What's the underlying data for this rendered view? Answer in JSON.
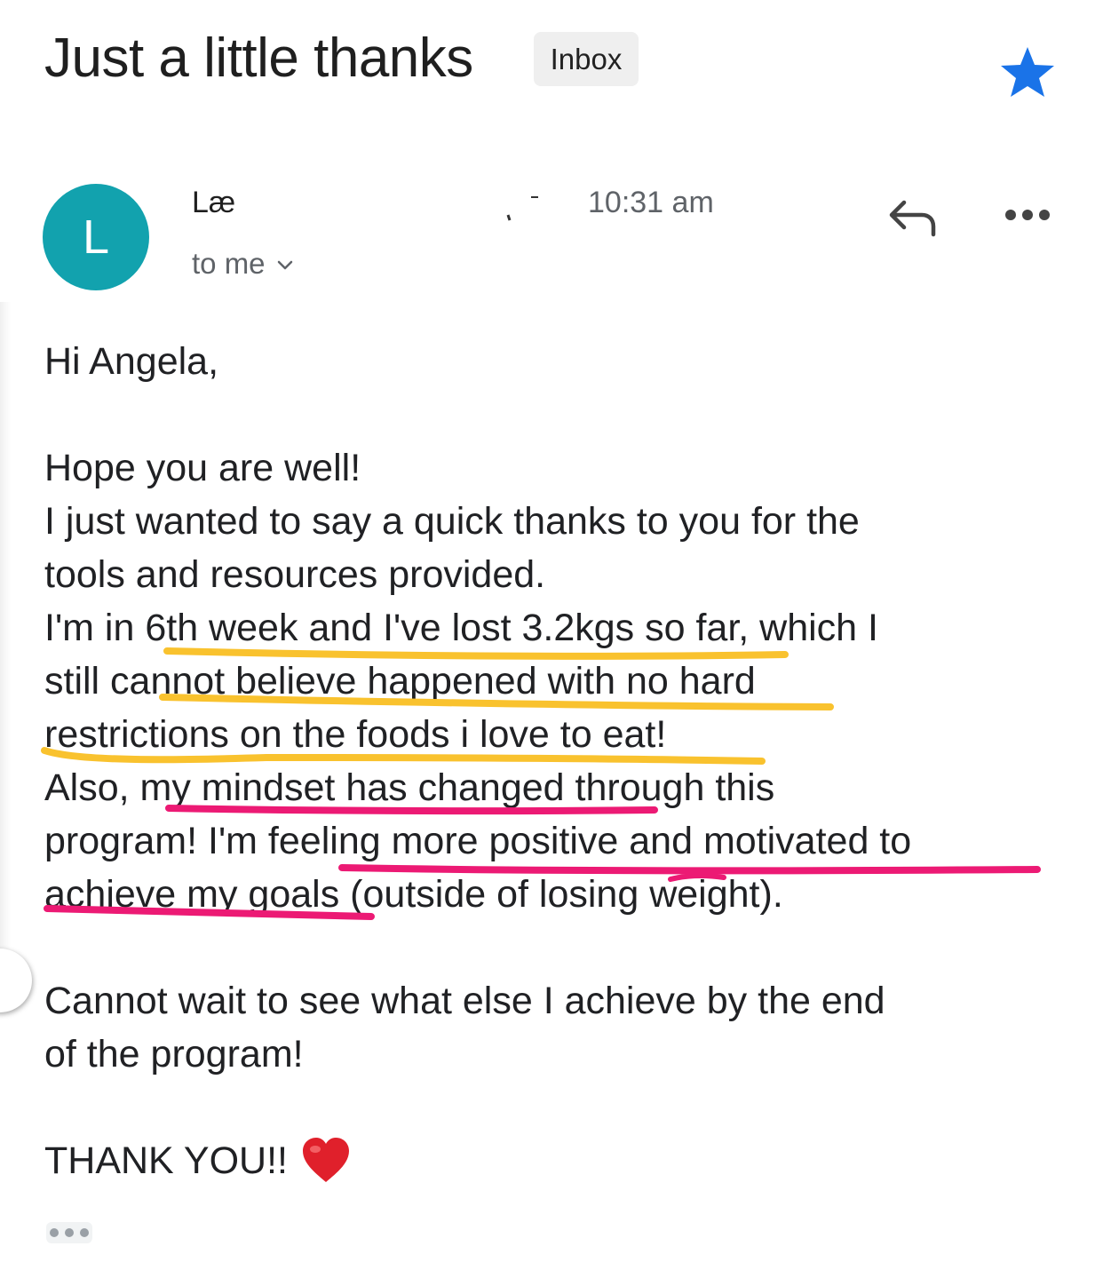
{
  "email": {
    "subject": "Just a little thanks",
    "label": "Inbox",
    "starred": true,
    "sender_initial": "L",
    "sender_name": "Læ",
    "time": "10:31 am",
    "recipient": "to me"
  },
  "body": {
    "greeting": "Hi Angela,",
    "lines": [
      "Hope you are well!",
      "I just wanted to say a quick thanks to you for the",
      "tools and resources provided.",
      "I'm in 6th week and I've lost 3.2kgs so far, which I",
      "still cannot believe happened with no hard",
      "restrictions on the foods i love to eat!",
      "Also, my mindset has changed through this",
      "program! I'm feeling more positive and motivated to",
      "achieve my goals (outside of losing weight)."
    ],
    "closing_lines": [
      "Cannot wait to see what else I achieve by the end",
      "of the program!"
    ],
    "signoff": "THANK YOU!!"
  },
  "icons": {
    "star": "star-icon",
    "reply": "reply-icon",
    "more": "more-options-icon",
    "chevron": "chevron-down-icon",
    "heart": "red-heart-icon"
  },
  "colors": {
    "avatar": "#12a2ae",
    "star": "#1a73e8",
    "highlight_yellow": "#f9c22e",
    "highlight_pink": "#ec1a74",
    "heart": "#e0202b"
  }
}
